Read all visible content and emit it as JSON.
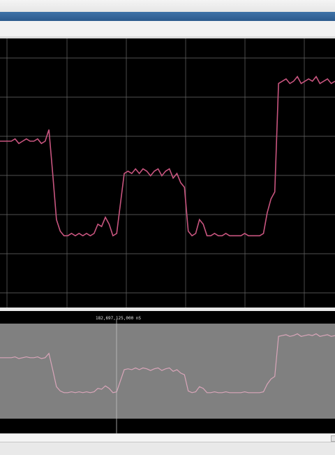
{
  "cursor": {
    "label": "182,697,125,000 nS"
  },
  "colors": {
    "trace": "#c8557f",
    "overview_trace": "#d9a5b9",
    "grid": "#6a6a6a",
    "plot_bg": "#000000",
    "overview_bg": "#808080",
    "titlebar": "#2f5f92"
  },
  "chart_data": {
    "type": "line",
    "series": [
      {
        "values": [
          0.6,
          0.6,
          0.6,
          0.6,
          0.61,
          0.59,
          0.6,
          0.61,
          0.6,
          0.6,
          0.61,
          0.59,
          0.6,
          0.65,
          0.46,
          0.26,
          0.21,
          0.19,
          0.19,
          0.2,
          0.19,
          0.2,
          0.19,
          0.2,
          0.19,
          0.2,
          0.24,
          0.23,
          0.27,
          0.24,
          0.19,
          0.2,
          0.33,
          0.46,
          0.47,
          0.46,
          0.48,
          0.46,
          0.48,
          0.47,
          0.45,
          0.47,
          0.48,
          0.45,
          0.47,
          0.48,
          0.44,
          0.46,
          0.42,
          0.4,
          0.21,
          0.19,
          0.2,
          0.26,
          0.24,
          0.19,
          0.19,
          0.2,
          0.19,
          0.19,
          0.2,
          0.19,
          0.19,
          0.19,
          0.19,
          0.2,
          0.19,
          0.19,
          0.19,
          0.19,
          0.2,
          0.29,
          0.35,
          0.38,
          0.85,
          0.86,
          0.87,
          0.85,
          0.86,
          0.88,
          0.85,
          0.86,
          0.87,
          0.86,
          0.88,
          0.85,
          0.86,
          0.87,
          0.85,
          0.86
        ]
      }
    ]
  }
}
